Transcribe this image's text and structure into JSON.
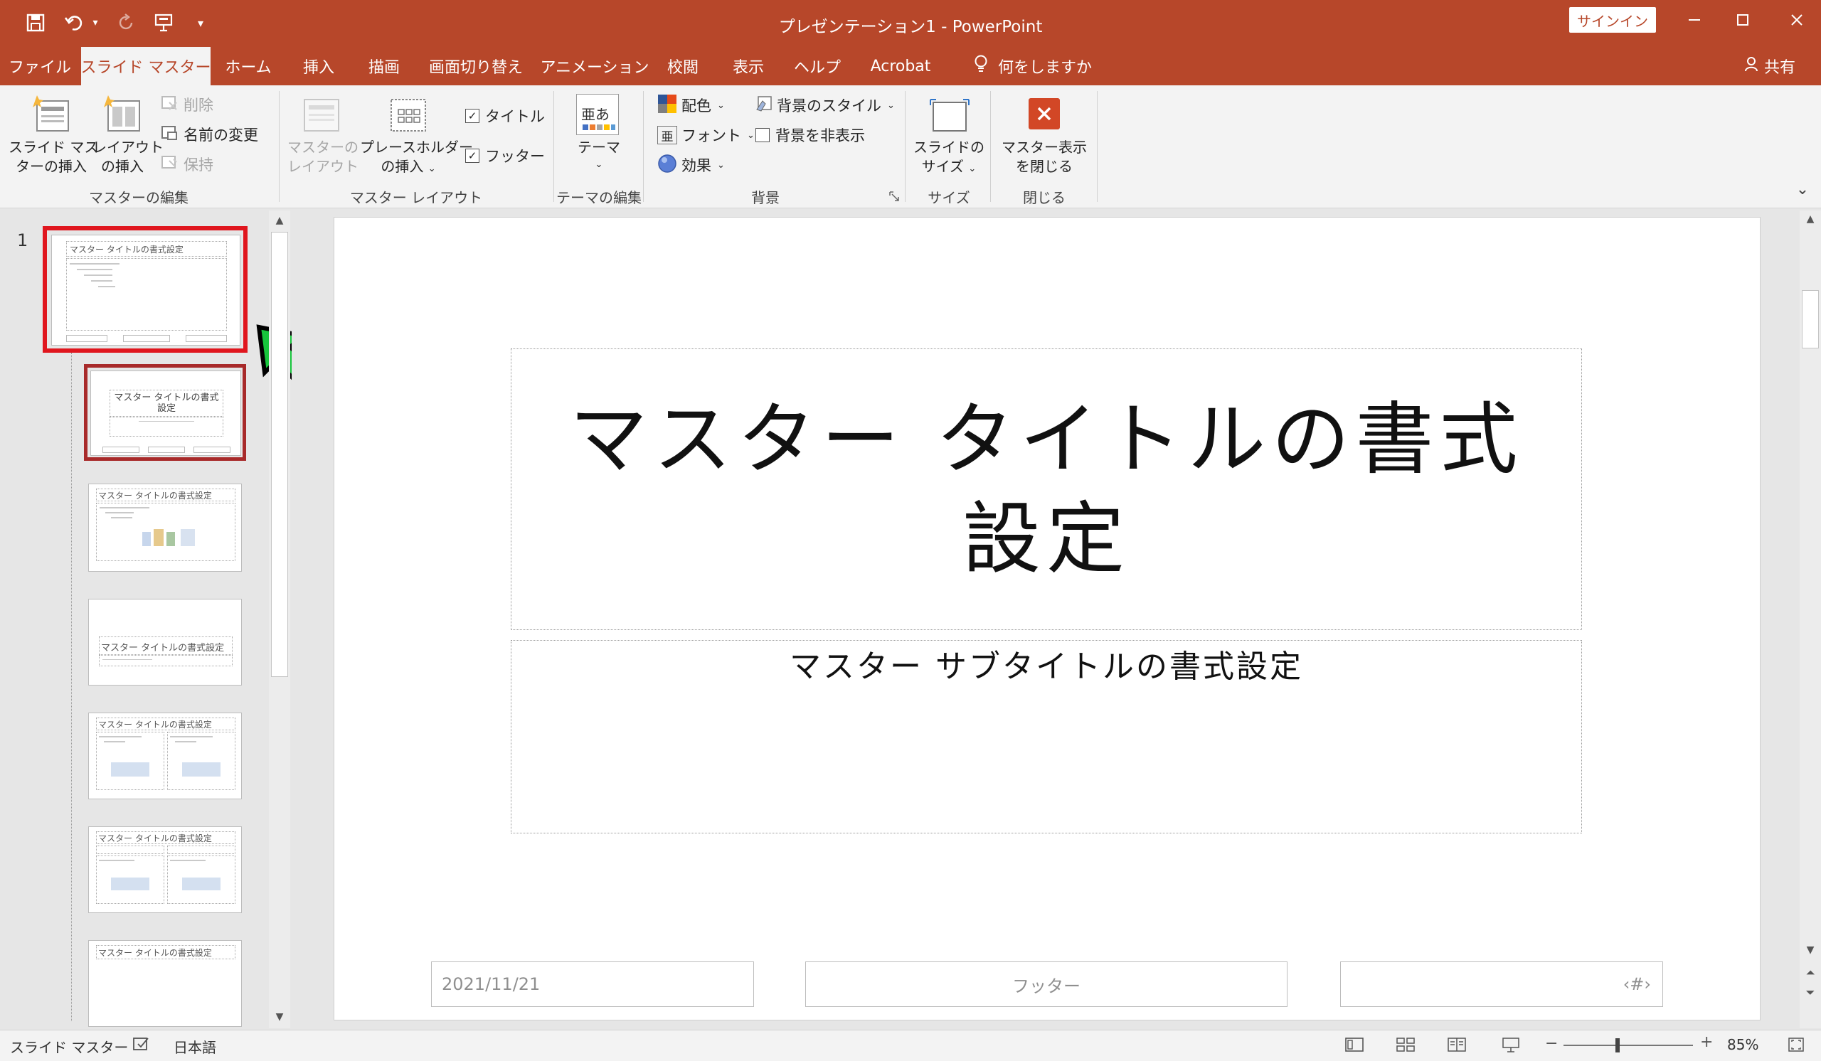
{
  "window": {
    "doc_title": "プレゼンテーション1  -  PowerPoint",
    "signin_label": "サインイン"
  },
  "tabs": [
    {
      "label": "ファイル"
    },
    {
      "label": "スライド マスター"
    },
    {
      "label": "ホーム"
    },
    {
      "label": "挿入"
    },
    {
      "label": "描画"
    },
    {
      "label": "画面切り替え"
    },
    {
      "label": "アニメーション"
    },
    {
      "label": "校閲"
    },
    {
      "label": "表示"
    },
    {
      "label": "ヘルプ"
    },
    {
      "label": "Acrobat"
    }
  ],
  "tellme_label": "何をしますか",
  "share_label": "共有",
  "ribbon": {
    "master_edit": {
      "insert_master_l1": "スライド マス",
      "insert_master_l2": "ターの挿入",
      "insert_layout_l1": "レイアウト",
      "insert_layout_l2": "の挿入",
      "delete": "削除",
      "rename": "名前の変更",
      "preserve": "保持",
      "group_label": "マスターの編集"
    },
    "master_layout": {
      "master_layout_l1": "マスターの",
      "master_layout_l2": "レイアウト",
      "insert_placeholder_l1": "プレースホルダー",
      "insert_placeholder_l2": "の挿入",
      "title_check": "タイトル",
      "footer_check": "フッター",
      "group_label": "マスター レイアウト"
    },
    "theme_edit": {
      "theme": "テーマ",
      "group_label": "テーマの編集"
    },
    "background": {
      "colors": "配色",
      "fonts": "フォント",
      "effects": "効果",
      "bg_styles": "背景のスタイル",
      "hide_bg": "背景を非表示",
      "group_label": "背景"
    },
    "size": {
      "slide_size_l1": "スライドの",
      "slide_size_l2": "サイズ",
      "group_label": "サイズ"
    },
    "close": {
      "close_master_l1": "マスター表示",
      "close_master_l2": "を閉じる",
      "group_label": "閉じる"
    }
  },
  "thumbnails": {
    "slide_number": "1",
    "master_title_small": "マスター タイトルの書式設定",
    "title_layout_title": "マスター タイトルの書式設定"
  },
  "slide": {
    "title_line1": "マスター タイトルの書式",
    "title_line2": "設定",
    "subtitle": "マスター サブタイトルの書式設定",
    "date": "2021/11/21",
    "footer": "フッター",
    "page_number": "‹#›"
  },
  "status": {
    "view_name": "スライド マスター",
    "language": "日本語",
    "zoom_percent": 85,
    "zoom_label": "85%"
  },
  "colors": {
    "accent": "#b7472a",
    "selection_red": "#e0161e",
    "arrow_green": "#17c53c"
  }
}
